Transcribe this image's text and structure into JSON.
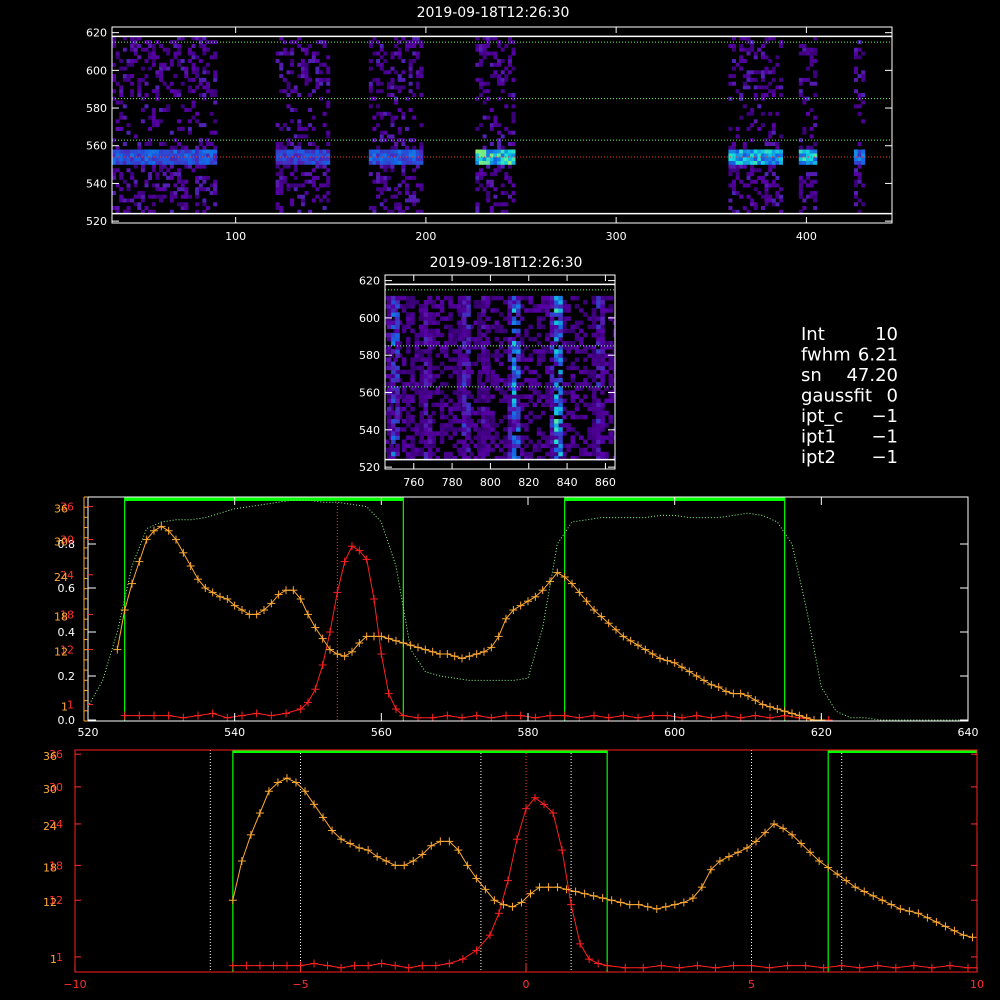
{
  "colors": {
    "background": "#000000",
    "axes": "#ffffff",
    "red_series": "#ff2020",
    "orange_series": "#ffaa33",
    "green_lines": "#00ff00",
    "green_dotted": "#88ff88",
    "highlight_bar": "#00ff00"
  },
  "stats": [
    {
      "label": "Int",
      "value": "10"
    },
    {
      "label": "fwhm",
      "value": "6.21"
    },
    {
      "label": "sn",
      "value": "47.20"
    },
    {
      "label": "gaussfit",
      "value": "0"
    },
    {
      "label": "ipt_c",
      "value": "−1"
    },
    {
      "label": "ipt1",
      "value": "−1"
    },
    {
      "label": "ipt2",
      "value": "−1"
    }
  ],
  "chart_data": [
    {
      "id": "top_image",
      "type": "heatmap",
      "title": "2019-09-18T12:26:30",
      "xlim": [
        35,
        445
      ],
      "ylim": [
        519,
        623
      ],
      "xticks": [
        100,
        200,
        300,
        400
      ],
      "yticks": [
        520,
        540,
        560,
        580,
        600,
        620
      ],
      "white_hlines": [
        524,
        618
      ],
      "green_dotted_hlines": [
        563,
        585,
        615
      ],
      "red_dotted_hlines": [
        554
      ],
      "bands": [
        {
          "x0": 35,
          "x1": 90,
          "strength": 0.55
        },
        {
          "x0": 121,
          "x1": 148,
          "strength": 0.5
        },
        {
          "x0": 170,
          "x1": 198,
          "strength": 0.55
        },
        {
          "x0": 226,
          "x1": 246,
          "strength": 0.9
        },
        {
          "x0": 359,
          "x1": 386,
          "strength": 0.8
        },
        {
          "x0": 396,
          "x1": 404,
          "strength": 0.85
        },
        {
          "x0": 425,
          "x1": 429,
          "strength": 0.6
        }
      ],
      "emission_row": 553
    },
    {
      "id": "small_image",
      "type": "heatmap",
      "title": "2019-09-18T12:26:30",
      "xlim": [
        745,
        865
      ],
      "ylim": [
        519,
        623
      ],
      "xticks": [
        760,
        780,
        800,
        820,
        840,
        860
      ],
      "yticks": [
        520,
        540,
        560,
        580,
        600,
        620
      ],
      "white_hlines": [
        524,
        618
      ],
      "green_dotted_hlines": [
        563,
        585,
        615
      ],
      "streaks": [
        {
          "x": 749,
          "strength": 0.7
        },
        {
          "x": 766,
          "strength": 0.4
        },
        {
          "x": 786,
          "strength": 0.5
        },
        {
          "x": 796,
          "strength": 0.35
        },
        {
          "x": 812,
          "strength": 0.85
        },
        {
          "x": 834,
          "strength": 1.0
        },
        {
          "x": 856,
          "strength": 0.45
        }
      ]
    },
    {
      "id": "wavelength_profile",
      "type": "line",
      "xlim": [
        520,
        640
      ],
      "xticks": [
        520,
        540,
        560,
        580,
        600,
        620,
        640
      ],
      "left_ticks_white": [
        0.0,
        0.2,
        0.4,
        0.6,
        0.8
      ],
      "left_ticks_red": [
        1,
        12,
        18,
        24,
        30,
        36
      ],
      "left_ticks_orange": [
        1,
        12,
        18,
        24,
        30,
        36
      ],
      "tick_labels_white": [
        "0.0",
        "0.2",
        "0.4",
        "0.6",
        "0.8"
      ],
      "tick_labels_red": [
        "1",
        "12",
        "18",
        "24",
        "30",
        "36"
      ],
      "tick_labels_orange": [
        "1",
        "12",
        "18",
        "24",
        "30",
        "36"
      ],
      "green_vlines": [
        525,
        563,
        585,
        615
      ],
      "green_top_bars": [
        [
          525,
          563
        ],
        [
          585,
          615
        ]
      ],
      "red_dotted_vline": 554,
      "series": [
        {
          "color": "red",
          "x": [
            525,
            527,
            529,
            531,
            533,
            535,
            537,
            539,
            541,
            543,
            545,
            547,
            549,
            550,
            551,
            552,
            553,
            554,
            555,
            556,
            557,
            558,
            559,
            560,
            561,
            562,
            563,
            565,
            567,
            569,
            571,
            573,
            575,
            577,
            579,
            581,
            583,
            585,
            587,
            589,
            591,
            593,
            595,
            597,
            599,
            601,
            603,
            605,
            607,
            609,
            611,
            613,
            615,
            617,
            619,
            621
          ],
          "y": [
            0.02,
            0.02,
            0.02,
            0.02,
            0.01,
            0.02,
            0.03,
            0.01,
            0.02,
            0.03,
            0.02,
            0.03,
            0.05,
            0.08,
            0.14,
            0.25,
            0.4,
            0.58,
            0.72,
            0.79,
            0.77,
            0.73,
            0.55,
            0.3,
            0.12,
            0.05,
            0.02,
            0.01,
            0.01,
            0.02,
            0.01,
            0.02,
            0.01,
            0.02,
            0.02,
            0.01,
            0.02,
            0.02,
            0.01,
            0.02,
            0.01,
            0.02,
            0.01,
            0.02,
            0.02,
            0.01,
            0.02,
            0.01,
            0.02,
            0.01,
            0.02,
            0.01,
            0.02,
            0.01,
            0.0,
            0.0
          ]
        },
        {
          "color": "orange",
          "x": [
            524,
            525,
            526,
            527,
            528,
            529,
            530,
            531,
            532,
            533,
            534,
            535,
            536,
            537,
            538,
            539,
            540,
            541,
            542,
            543,
            544,
            545,
            546,
            547,
            548,
            549,
            550,
            551,
            552,
            553,
            554,
            555,
            556,
            557,
            558,
            559,
            560,
            561,
            562,
            563,
            564,
            565,
            566,
            567,
            568,
            569,
            570,
            571,
            572,
            573,
            574,
            575,
            576,
            577,
            578,
            579,
            580,
            581,
            582,
            583,
            584,
            585,
            586,
            587,
            588,
            589,
            590,
            591,
            592,
            593,
            594,
            595,
            596,
            597,
            598,
            599,
            600,
            601,
            602,
            603,
            604,
            605,
            606,
            607,
            608,
            609,
            610,
            611,
            612,
            613,
            614,
            615,
            616,
            617,
            618,
            619,
            620
          ],
          "y": [
            0.32,
            0.5,
            0.62,
            0.72,
            0.82,
            0.86,
            0.88,
            0.86,
            0.82,
            0.76,
            0.7,
            0.64,
            0.6,
            0.58,
            0.56,
            0.55,
            0.52,
            0.5,
            0.48,
            0.48,
            0.5,
            0.53,
            0.57,
            0.59,
            0.59,
            0.55,
            0.48,
            0.42,
            0.37,
            0.32,
            0.3,
            0.29,
            0.31,
            0.35,
            0.38,
            0.38,
            0.38,
            0.37,
            0.36,
            0.35,
            0.34,
            0.33,
            0.32,
            0.31,
            0.3,
            0.3,
            0.29,
            0.28,
            0.29,
            0.3,
            0.31,
            0.33,
            0.38,
            0.46,
            0.5,
            0.52,
            0.54,
            0.56,
            0.59,
            0.63,
            0.67,
            0.65,
            0.62,
            0.58,
            0.54,
            0.5,
            0.47,
            0.44,
            0.41,
            0.38,
            0.36,
            0.34,
            0.32,
            0.3,
            0.28,
            0.27,
            0.26,
            0.24,
            0.22,
            0.2,
            0.18,
            0.16,
            0.15,
            0.13,
            0.12,
            0.12,
            0.11,
            0.09,
            0.07,
            0.06,
            0.05,
            0.04,
            0.03,
            0.02,
            0.01,
            0.0,
            0.0
          ]
        },
        {
          "color": "green_dotted",
          "x": [
            520,
            522,
            524,
            526,
            528,
            530,
            532,
            534,
            536,
            538,
            540,
            542,
            544,
            546,
            548,
            550,
            552,
            554,
            556,
            558,
            560,
            562,
            564,
            566,
            568,
            570,
            572,
            574,
            576,
            578,
            580,
            582,
            584,
            586,
            588,
            590,
            592,
            594,
            596,
            598,
            600,
            602,
            604,
            606,
            608,
            610,
            612,
            614,
            616,
            618,
            620,
            622,
            624,
            626,
            628,
            630,
            632,
            634,
            636,
            638,
            640
          ],
          "y": [
            0.06,
            0.18,
            0.4,
            0.7,
            0.87,
            0.9,
            0.91,
            0.91,
            0.92,
            0.94,
            0.96,
            0.97,
            0.98,
            0.99,
            1.0,
            1.0,
            0.99,
            0.99,
            0.98,
            0.97,
            0.9,
            0.7,
            0.32,
            0.22,
            0.2,
            0.19,
            0.18,
            0.18,
            0.18,
            0.18,
            0.19,
            0.42,
            0.8,
            0.9,
            0.91,
            0.92,
            0.92,
            0.92,
            0.92,
            0.93,
            0.93,
            0.92,
            0.92,
            0.92,
            0.93,
            0.94,
            0.93,
            0.9,
            0.8,
            0.5,
            0.15,
            0.04,
            0.01,
            0.01,
            0.0,
            0.0,
            0.0,
            0.0,
            0.0,
            0.0,
            0.0
          ]
        }
      ]
    },
    {
      "id": "velocity_profile",
      "type": "line",
      "xlim": [
        -10,
        10
      ],
      "xticks": [
        -10,
        -5,
        0,
        5,
        10
      ],
      "tick_labels": [
        "−10",
        "−5",
        "0",
        "5",
        "10"
      ],
      "left_ticks_red": [
        1,
        12,
        18,
        24,
        30,
        36
      ],
      "left_ticks_orange": [
        1,
        12,
        18,
        24,
        30,
        36
      ],
      "tick_labels_red": [
        "1",
        "12",
        "18",
        "24",
        "30",
        "36"
      ],
      "tick_labels_orange": [
        "1",
        "12",
        "18",
        "24",
        "30",
        "36"
      ],
      "green_vlines": [
        -6.5,
        1.8,
        6.7
      ],
      "green_top_bars": [
        [
          -6.5,
          1.8
        ],
        [
          6.7,
          10
        ]
      ],
      "white_dotted_vlines": [
        -7.0,
        -5.0,
        -1.0,
        1.0,
        5.0,
        7.0
      ],
      "red_dotted_vline": 0,
      "series": [
        {
          "color": "red",
          "x": [
            -6.5,
            -6.2,
            -5.9,
            -5.6,
            -5.3,
            -5.0,
            -4.7,
            -4.4,
            -4.1,
            -3.8,
            -3.5,
            -3.2,
            -2.9,
            -2.6,
            -2.3,
            -2.0,
            -1.7,
            -1.4,
            -1.1,
            -0.8,
            -0.6,
            -0.4,
            -0.2,
            0.0,
            0.2,
            0.4,
            0.6,
            0.8,
            1.0,
            1.2,
            1.4,
            1.6,
            1.8,
            2.2,
            2.6,
            3.0,
            3.4,
            3.8,
            4.2,
            4.6,
            5.0,
            5.4,
            5.8,
            6.2,
            6.6,
            7.0,
            7.4,
            7.8,
            8.2,
            8.6,
            9.0,
            9.4,
            9.8,
            10.0
          ],
          "y": [
            0.02,
            0.02,
            0.02,
            0.02,
            0.02,
            0.02,
            0.03,
            0.02,
            0.01,
            0.02,
            0.02,
            0.03,
            0.02,
            0.01,
            0.02,
            0.02,
            0.03,
            0.05,
            0.09,
            0.16,
            0.26,
            0.41,
            0.6,
            0.74,
            0.79,
            0.76,
            0.72,
            0.55,
            0.3,
            0.12,
            0.05,
            0.03,
            0.02,
            0.01,
            0.01,
            0.02,
            0.01,
            0.02,
            0.01,
            0.02,
            0.02,
            0.01,
            0.02,
            0.02,
            0.01,
            0.02,
            0.01,
            0.02,
            0.01,
            0.02,
            0.01,
            0.02,
            0.01,
            0.01
          ]
        },
        {
          "color": "orange",
          "x": [
            -6.5,
            -6.3,
            -6.1,
            -5.9,
            -5.7,
            -5.5,
            -5.3,
            -5.1,
            -4.9,
            -4.7,
            -4.5,
            -4.3,
            -4.1,
            -3.9,
            -3.7,
            -3.5,
            -3.3,
            -3.1,
            -2.9,
            -2.7,
            -2.5,
            -2.3,
            -2.1,
            -1.9,
            -1.7,
            -1.5,
            -1.3,
            -1.1,
            -0.9,
            -0.7,
            -0.5,
            -0.3,
            -0.1,
            0.1,
            0.3,
            0.5,
            0.7,
            0.9,
            1.1,
            1.3,
            1.5,
            1.7,
            1.9,
            2.1,
            2.3,
            2.5,
            2.7,
            2.9,
            3.1,
            3.3,
            3.5,
            3.7,
            3.9,
            4.1,
            4.3,
            4.5,
            4.7,
            4.9,
            5.1,
            5.3,
            5.5,
            5.7,
            5.9,
            6.1,
            6.3,
            6.5,
            6.7,
            6.9,
            7.1,
            7.3,
            7.5,
            7.7,
            7.9,
            8.1,
            8.3,
            8.5,
            8.7,
            8.9,
            9.1,
            9.3,
            9.5,
            9.7,
            9.9
          ],
          "y": [
            0.32,
            0.5,
            0.62,
            0.72,
            0.82,
            0.86,
            0.88,
            0.86,
            0.82,
            0.76,
            0.7,
            0.64,
            0.6,
            0.58,
            0.56,
            0.55,
            0.52,
            0.5,
            0.48,
            0.48,
            0.5,
            0.53,
            0.57,
            0.59,
            0.59,
            0.55,
            0.48,
            0.42,
            0.37,
            0.32,
            0.3,
            0.29,
            0.31,
            0.35,
            0.38,
            0.38,
            0.38,
            0.37,
            0.36,
            0.35,
            0.34,
            0.33,
            0.32,
            0.31,
            0.3,
            0.3,
            0.29,
            0.28,
            0.29,
            0.3,
            0.31,
            0.33,
            0.38,
            0.46,
            0.5,
            0.52,
            0.54,
            0.56,
            0.59,
            0.63,
            0.67,
            0.65,
            0.62,
            0.58,
            0.54,
            0.5,
            0.47,
            0.44,
            0.41,
            0.38,
            0.36,
            0.34,
            0.32,
            0.3,
            0.28,
            0.27,
            0.26,
            0.24,
            0.22,
            0.2,
            0.18,
            0.16,
            0.15
          ]
        }
      ]
    }
  ]
}
